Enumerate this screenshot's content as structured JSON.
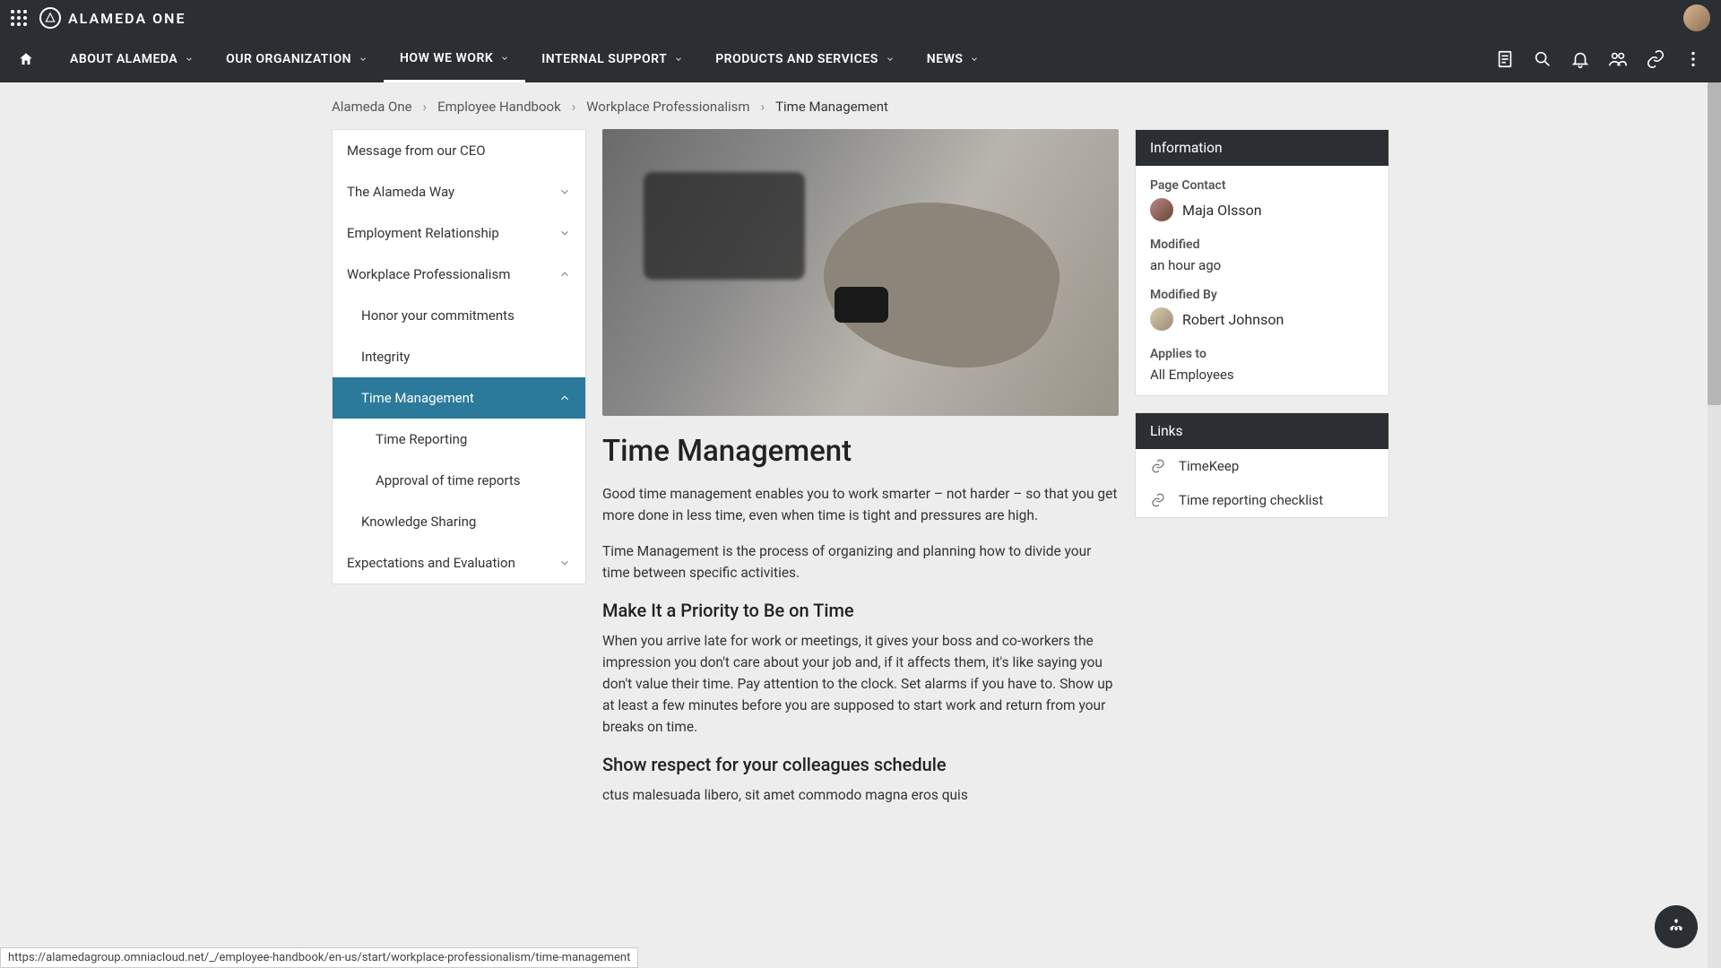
{
  "brand": "ALAMEDA ONE",
  "nav": [
    {
      "label": "ABOUT ALAMEDA"
    },
    {
      "label": "OUR ORGANIZATION"
    },
    {
      "label": "HOW WE WORK",
      "active": true
    },
    {
      "label": "INTERNAL SUPPORT"
    },
    {
      "label": "PRODUCTS AND SERVICES"
    },
    {
      "label": "NEWS"
    }
  ],
  "breadcrumb": [
    "Alameda One",
    "Employee Handbook",
    "Workplace Professionalism",
    "Time Management"
  ],
  "sidebar": [
    {
      "label": "Message from our CEO",
      "level": 0
    },
    {
      "label": "The Alameda Way",
      "level": 0,
      "expand": "down"
    },
    {
      "label": "Employment Relationship",
      "level": 0,
      "expand": "down"
    },
    {
      "label": "Workplace Professionalism",
      "level": 0,
      "expand": "up"
    },
    {
      "label": "Honor your commitments",
      "level": 1
    },
    {
      "label": "Integrity",
      "level": 1
    },
    {
      "label": "Time Management",
      "level": 1,
      "active": true,
      "expand": "up"
    },
    {
      "label": "Time Reporting",
      "level": 2
    },
    {
      "label": "Approval of time reports",
      "level": 2
    },
    {
      "label": "Knowledge Sharing",
      "level": 1
    },
    {
      "label": "Expectations and Evaluation",
      "level": 0,
      "expand": "down"
    }
  ],
  "article": {
    "title": "Time Management",
    "lead": "Good time management enables you to work smarter – not harder – so that you get more done in less time, even when time is tight and pressures are high.",
    "p1": "Time Management is the process of organizing and planning how to divide your time between specific activities.",
    "h2a": "Make It a Priority to Be on Time",
    "p2": "When you arrive late for work or meetings, it gives your boss and co-workers the impression you don't care about your job and, if it affects them, it's like saying you don't value their time. Pay attention to the clock. Set alarms if you have to. Show up at least a few minutes before you are supposed to start work and return from your breaks on time.",
    "h2b": "Show respect for your colleagues schedule",
    "p3": "ctus malesuada libero, sit amet commodo magna eros quis"
  },
  "info": {
    "title": "Information",
    "contact_label": "Page Contact",
    "contact": "Maja Olsson",
    "modified_label": "Modified",
    "modified": "an hour ago",
    "modifiedby_label": "Modified By",
    "modifiedby": "Robert Johnson",
    "applies_label": "Applies to",
    "applies": "All Employees"
  },
  "links": {
    "title": "Links",
    "items": [
      "TimeKeep",
      "Time reporting checklist"
    ]
  },
  "urlbar": "https://alamedagroup.omniacloud.net/_/employee-handbook/en-us/start/workplace-professionalism/time-management"
}
